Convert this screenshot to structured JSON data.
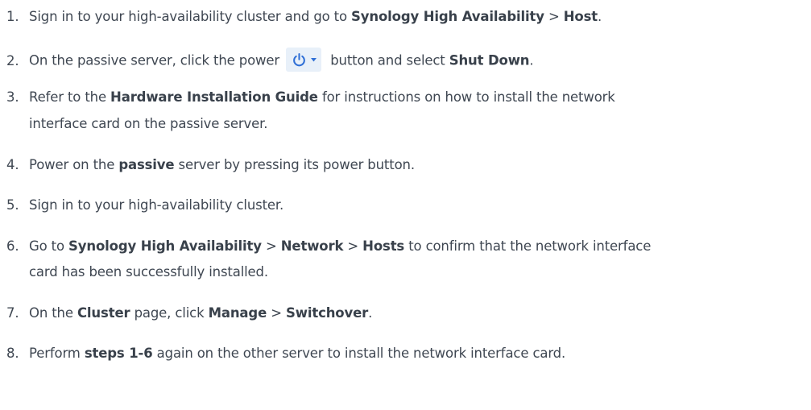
{
  "steps": [
    {
      "num": "1.",
      "a": "Sign in to your high-availability cluster and go to ",
      "b1": "Synology High Availability",
      "sep1": " > ",
      "b2": "Host",
      "end": "."
    },
    {
      "num": "2.",
      "a": "On the passive server, click the power ",
      "icon": "power-icon",
      "c": " button and select ",
      "b1": "Shut Down",
      "end": "."
    },
    {
      "num": "3.",
      "a": "Refer to the ",
      "b1": "Hardware Installation Guide",
      "c": " for instructions on how to install the network",
      "line2": "interface card on the passive server."
    },
    {
      "num": "4.",
      "a": "Power on the ",
      "b1": "passive",
      "c": " server by pressing its power button."
    },
    {
      "num": "5.",
      "a": "Sign in to your high-availability cluster."
    },
    {
      "num": "6.",
      "a": "Go to ",
      "b1": "Synology High Availability",
      "sep1": " > ",
      "b2": "Network",
      "sep2": " > ",
      "b3": "Hosts",
      "c": " to confirm that the network interface",
      "line2": "card has been successfully installed."
    },
    {
      "num": "7.",
      "a": "On the ",
      "b1": "Cluster",
      "c": " page, click ",
      "b2": "Manage",
      "sep2": " > ",
      "b3": "Switchover",
      "end": "."
    },
    {
      "num": "8.",
      "a": "Perform ",
      "b1": "steps 1-6",
      "c": " again on the other server to install the network interface card."
    }
  ],
  "colors": {
    "text": "#3f4752",
    "icon": "#2f6fd6",
    "icon_bg": "#e8f0f9"
  }
}
